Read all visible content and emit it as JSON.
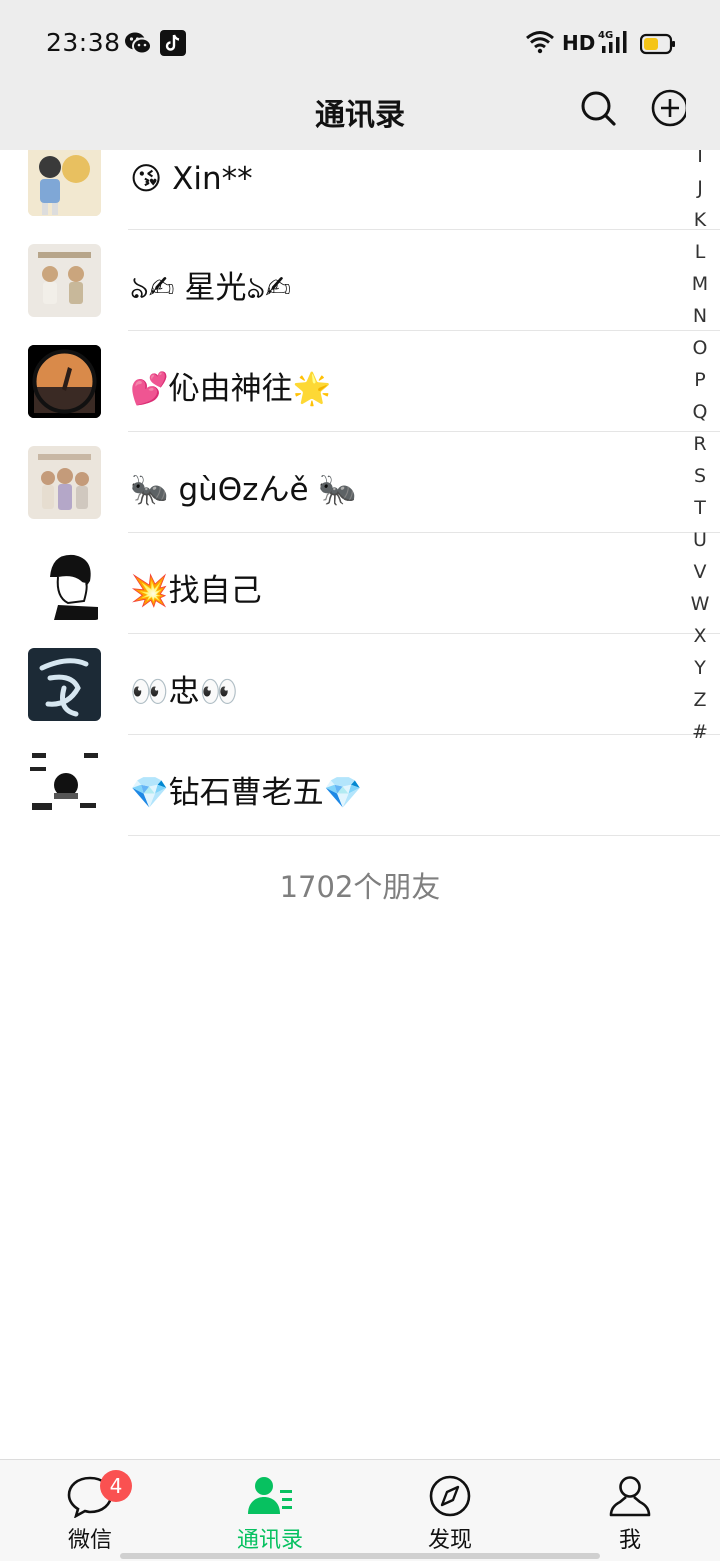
{
  "status_bar": {
    "time": "23:38",
    "network": "HD",
    "signal_type": "4G",
    "icons": [
      "wechat-icon",
      "tiktok-icon",
      "wifi-icon",
      "signal-icon",
      "battery-icon"
    ]
  },
  "header": {
    "title": "通讯录",
    "actions": [
      "search-icon",
      "add-circle-icon"
    ]
  },
  "contacts": [
    {
      "name": "😘  Xin**"
    },
    {
      "name": "ঌ✍ 星光ঌ✍"
    },
    {
      "name": "💕伈由神往🌟"
    },
    {
      "name": "🐜 gùΘzんě 🐜"
    },
    {
      "name": "💥找自己"
    },
    {
      "name": "👀忠👀"
    },
    {
      "name": "💎钻石曹老五💎"
    }
  ],
  "index_letters": [
    "I",
    "J",
    "K",
    "L",
    "M",
    "N",
    "O",
    "P",
    "Q",
    "R",
    "S",
    "T",
    "U",
    "V",
    "W",
    "X",
    "Y",
    "Z",
    "#"
  ],
  "friend_count": "1702个朋友",
  "tabs": [
    {
      "label": "微信",
      "badge": "4",
      "icon": "chat-bubble-icon"
    },
    {
      "label": "通讯录",
      "icon": "contacts-icon",
      "active": true
    },
    {
      "label": "发现",
      "icon": "compass-icon"
    },
    {
      "label": "我",
      "icon": "person-icon"
    }
  ],
  "colors": {
    "accent": "#07c160",
    "badge": "#fa5151",
    "header_bg": "#ededed"
  }
}
